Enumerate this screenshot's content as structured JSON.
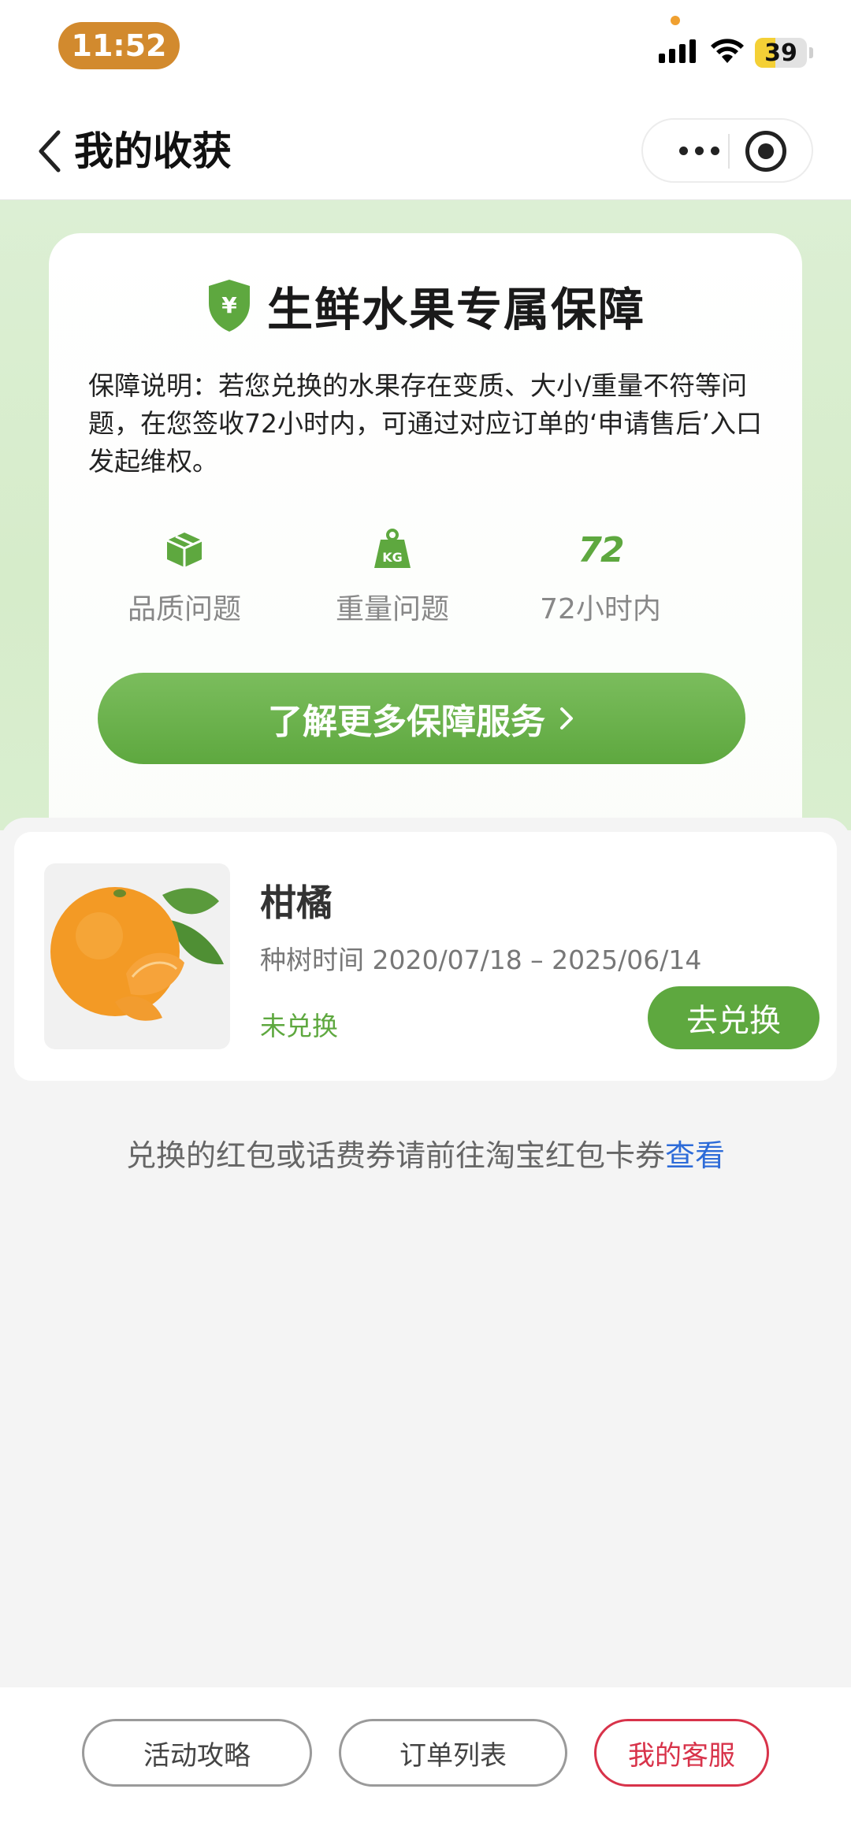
{
  "status_bar": {
    "time": "11:52",
    "battery": "39",
    "battery_level": 0.39
  },
  "nav": {
    "title": "我的收获",
    "back_icon": "chevron-left-icon",
    "more_icon": "more-dots-icon",
    "close_icon": "target-close-icon"
  },
  "guarantee": {
    "shield_symbol": "¥",
    "title": "生鲜水果专属保障",
    "description": "保障说明：若您兑换的水果存在变质、大小/重量不符等问题，在您签收72小时内，可通过对应订单的‘申请售后’入口发起维权。",
    "features": [
      {
        "icon": "box-icon",
        "label": "品质问题"
      },
      {
        "icon": "weight-kg-icon",
        "icon_text": "KG",
        "label": "重量问题"
      },
      {
        "icon": "seventy-two-icon",
        "icon_text": "72",
        "label": "72小时内"
      }
    ],
    "button_label": "了解更多保障服务",
    "accent_color": "#5ea83f"
  },
  "fruit_item": {
    "name": "柑橘",
    "plant_time": "种树时间 2020/07/18 – 2025/06/14",
    "status": "未兑换",
    "action_label": "去兑换"
  },
  "tip": {
    "text": "兑换的红包或话费券请前往淘宝红包卡券",
    "link": "查看"
  },
  "bottom_bar": {
    "buttons": [
      {
        "label": "活动攻略"
      },
      {
        "label": "订单列表"
      },
      {
        "label": "我的客服"
      }
    ]
  }
}
